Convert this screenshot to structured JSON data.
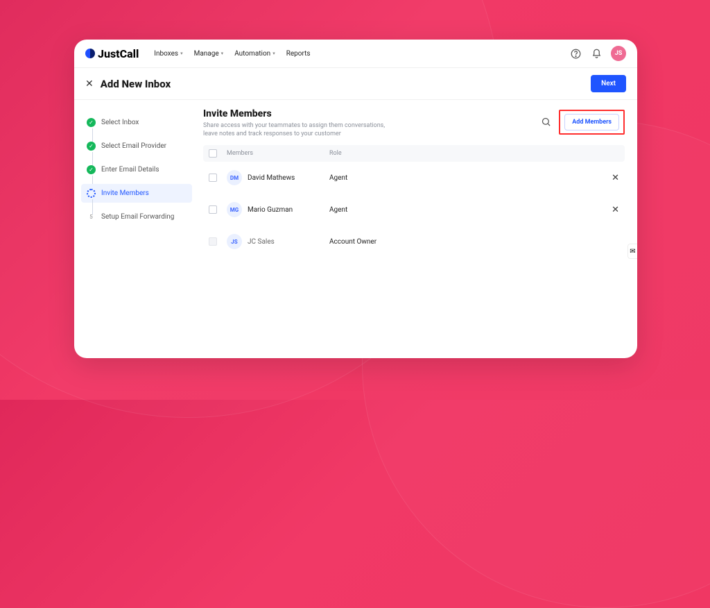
{
  "brand": "JustCall",
  "nav": [
    {
      "label": "Inboxes",
      "caret": true
    },
    {
      "label": "Manage",
      "caret": true
    },
    {
      "label": "Automation",
      "caret": true
    },
    {
      "label": "Reports",
      "caret": false
    }
  ],
  "avatar": "JS",
  "page_title": "Add New Inbox",
  "next_label": "Next",
  "steps": [
    {
      "label": "Select Inbox",
      "state": "done"
    },
    {
      "label": "Select Email Provider",
      "state": "done"
    },
    {
      "label": "Enter Email Details",
      "state": "done"
    },
    {
      "label": "Invite Members",
      "state": "current"
    },
    {
      "num": "5",
      "label": "Setup Email Forwarding",
      "state": "idle"
    }
  ],
  "section": {
    "title": "Invite Members",
    "sub": "Share access with your teammates to assign them conversations, leave notes and track responses to your customer",
    "add_members_label": "Add Members"
  },
  "table": {
    "headers": {
      "members": "Members",
      "role": "Role"
    },
    "rows": [
      {
        "initials": "DM",
        "name": "David Mathews",
        "role": "Agent",
        "removable": true
      },
      {
        "initials": "MG",
        "name": "Mario Guzman",
        "role": "Agent",
        "removable": true
      },
      {
        "initials": "JS",
        "name": "JC Sales",
        "role": "Account Owner",
        "removable": false
      }
    ]
  }
}
